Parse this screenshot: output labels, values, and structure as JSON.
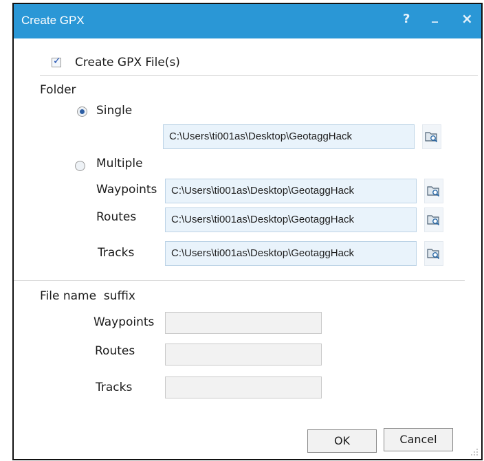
{
  "window": {
    "title": "Create GPX",
    "help_label": "?",
    "minimize_label": "_",
    "close_label": "×"
  },
  "create_files": {
    "label": "Create GPX File(s)",
    "checked": true
  },
  "folder": {
    "section_label": "Folder",
    "single": {
      "label": "Single",
      "selected": true,
      "path": "C:\\Users\\ti001as\\Desktop\\GeotaggHack"
    },
    "multiple": {
      "label": "Multiple",
      "selected": false,
      "waypoints_label": "Waypoints",
      "waypoints_path": "C:\\Users\\ti001as\\Desktop\\GeotaggHack",
      "routes_label": "Routes",
      "routes_path": "C:\\Users\\ti001as\\Desktop\\GeotaggHack",
      "tracks_label": "Tracks",
      "tracks_path": "C:\\Users\\ti001as\\Desktop\\GeotaggHack"
    }
  },
  "suffix": {
    "section_label": "File name  suffix",
    "waypoints_label": "Waypoints",
    "waypoints_value": "",
    "routes_label": "Routes",
    "routes_value": "",
    "tracks_label": "Tracks",
    "tracks_value": ""
  },
  "buttons": {
    "ok_label": "OK",
    "cancel_label": "Cancel"
  },
  "colors": {
    "titlebar": "#2a97d6",
    "input_bg": "#e9f3fb",
    "radio_dot": "#2e5fa5"
  },
  "icons": {
    "browse": "folder-browse-icon",
    "check": "checkmark-icon"
  }
}
